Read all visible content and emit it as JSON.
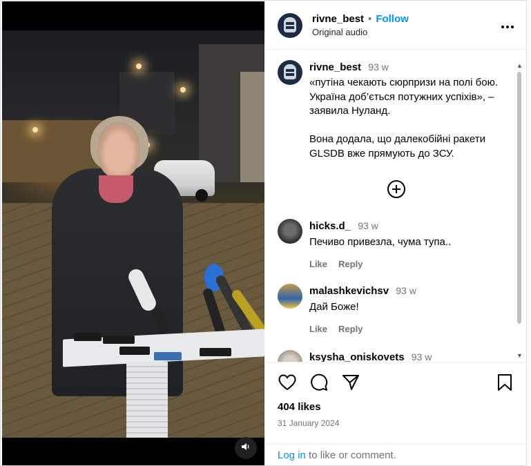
{
  "post": {
    "username": "rivne_best",
    "separator": "•",
    "follow_label": "Follow",
    "audio": "Original audio",
    "more_icon": "more-horizontal-icon"
  },
  "caption": {
    "username": "rivne_best",
    "age": "93 w",
    "text": "«путіна чекають сюрпризи на полі бою. Україна доб’ється потужних успіхів», – заявила Нуланд.\n\nВона додала, що далекобійні ракети GLSDB вже прямують до ЗСУ.",
    "load_more_icon": "plus-circle-icon"
  },
  "comments": [
    {
      "username": "hicks.d_",
      "age": "93 w",
      "text": "Печиво привезла, чума тупа..",
      "like": "Like",
      "reply": "Reply"
    },
    {
      "username": "malashkevichsv",
      "age": "93 w",
      "text": "Дай Боже!",
      "like": "Like",
      "reply": "Reply"
    },
    {
      "username": "ksysha_oniskovets",
      "age": "93 w"
    }
  ],
  "footer": {
    "likes": "404 likes",
    "date": "31 January 2024",
    "login_link": "Log in",
    "login_rest": " to like or comment."
  },
  "colors": {
    "link_blue": "#0095f6",
    "muted": "#737373",
    "border": "#dbdbdb"
  }
}
